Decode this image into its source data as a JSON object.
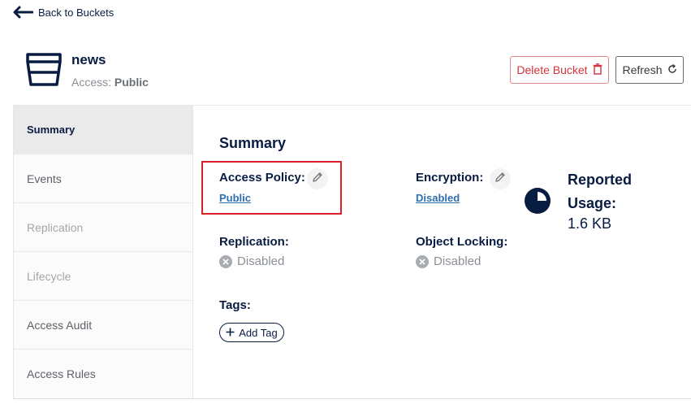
{
  "nav": {
    "back_label": "Back to Buckets"
  },
  "bucket": {
    "name": "news",
    "access_prefix": "Access:",
    "access_value": "Public"
  },
  "actions": {
    "delete_label": "Delete Bucket",
    "refresh_label": "Refresh"
  },
  "sidebar": {
    "items": [
      {
        "label": "Summary",
        "state": "active"
      },
      {
        "label": "Events",
        "state": "enabled"
      },
      {
        "label": "Replication",
        "state": "disabled"
      },
      {
        "label": "Lifecycle",
        "state": "disabled"
      },
      {
        "label": "Access Audit",
        "state": "enabled"
      },
      {
        "label": "Access Rules",
        "state": "enabled"
      }
    ]
  },
  "summary": {
    "title": "Summary",
    "access_policy": {
      "label": "Access Policy:",
      "value": "Public"
    },
    "encryption": {
      "label": "Encryption:",
      "value": "Disabled"
    },
    "replication": {
      "label": "Replication:",
      "value": "Disabled"
    },
    "object_locking": {
      "label": "Object Locking:",
      "value": "Disabled"
    },
    "tags": {
      "label": "Tags:",
      "add_label": "Add Tag"
    }
  },
  "usage": {
    "title": "Reported Usage:",
    "value": "1.6 KB"
  },
  "icons": {
    "back": "arrow-left-icon",
    "bucket": "bucket-icon",
    "delete": "trash-icon",
    "refresh": "refresh-icon",
    "edit": "pencil-icon",
    "disabled": "x-circle-icon",
    "add": "plus-icon",
    "usage": "pie-chart-icon"
  },
  "colors": {
    "primary": "#081c42",
    "danger": "#d1343c",
    "link": "#2e6fb0",
    "highlight": "#d8222a"
  }
}
